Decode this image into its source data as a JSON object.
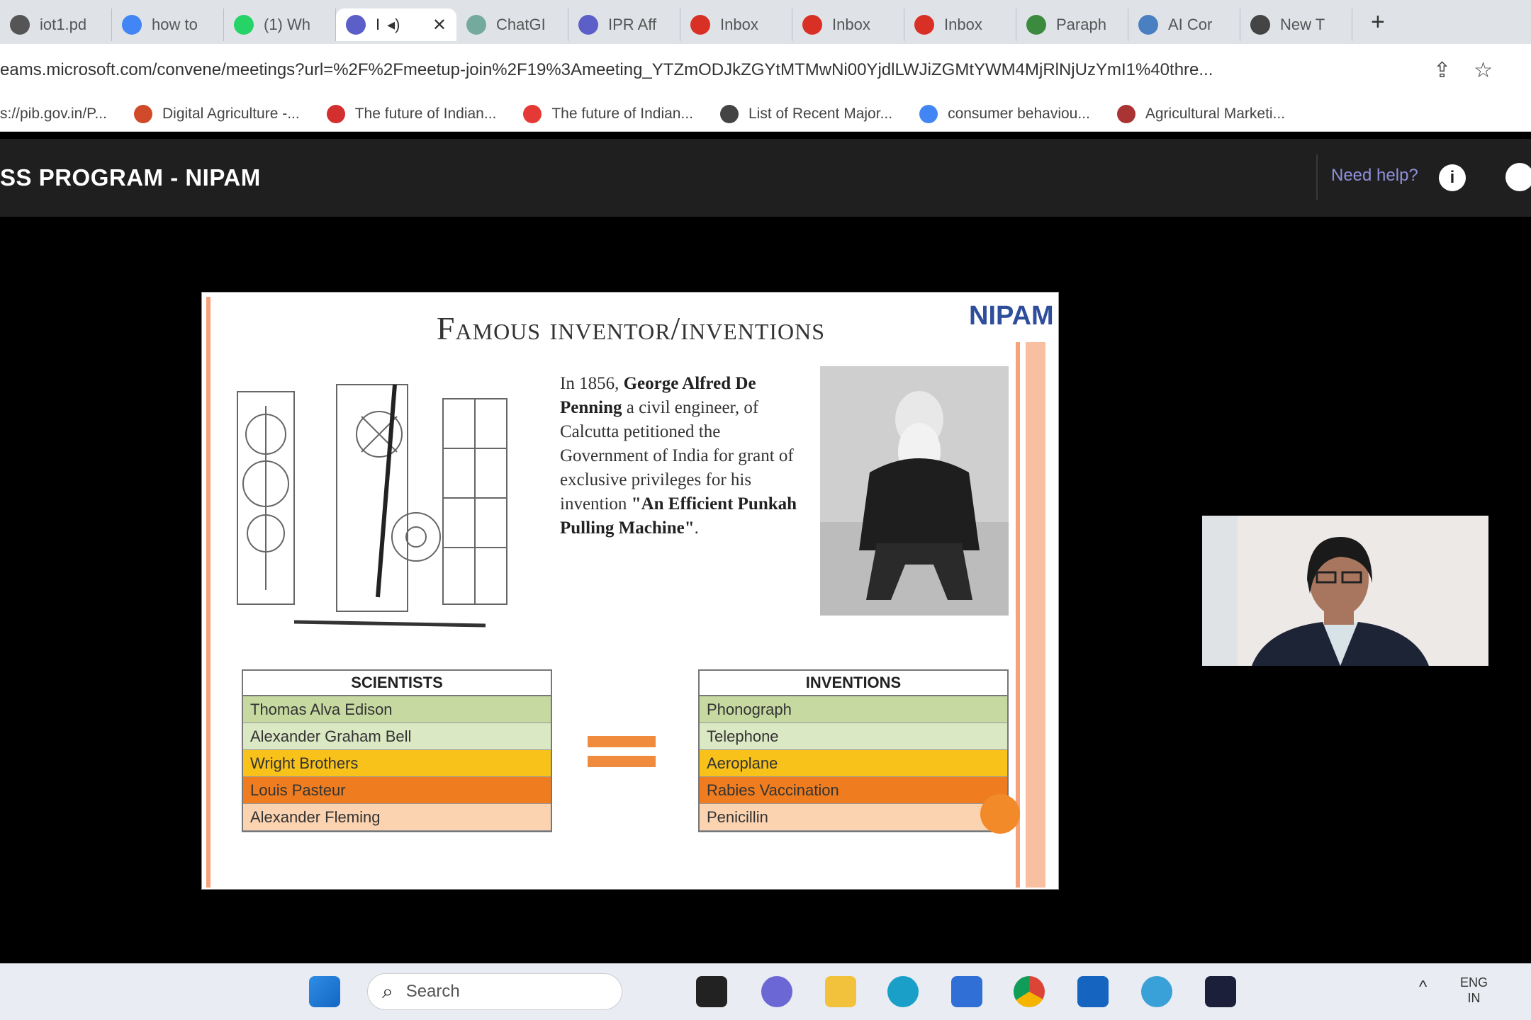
{
  "browser": {
    "tabs": [
      {
        "label": "iot1.pd",
        "icon": "globe-icon",
        "color": "#555555"
      },
      {
        "label": "how to",
        "icon": "google-icon",
        "color": "#4285f4"
      },
      {
        "label": "(1) Wh",
        "icon": "whatsapp-icon",
        "color": "#25d366"
      },
      {
        "label": "I",
        "icon": "teams-icon",
        "color": "#5b5fc7",
        "active": true
      },
      {
        "label": "ChatGI",
        "icon": "chatgpt-icon",
        "color": "#74aa9c"
      },
      {
        "label": "IPR Aff",
        "icon": "teams-icon",
        "color": "#5b5fc7"
      },
      {
        "label": "Inbox",
        "icon": "gmail-icon",
        "color": "#d93025"
      },
      {
        "label": "Inbox",
        "icon": "gmail-icon",
        "color": "#d93025"
      },
      {
        "label": "Inbox",
        "icon": "gmail-icon",
        "color": "#d93025"
      },
      {
        "label": "Paraph",
        "icon": "quillbot-icon",
        "color": "#3b8a3e"
      },
      {
        "label": "AI Cor",
        "icon": "ai-icon",
        "color": "#4a7fc1"
      },
      {
        "label": "New T",
        "icon": "chrome-icon",
        "color": "#444444"
      }
    ],
    "new_tab": "+",
    "url": "eams.microsoft.com/convene/meetings?url=%2F%2Fmeetup-join%2F19%3Ameeting_YTZmODJkZGYtMTMwNi00YjdlLWJiZGMtYWM4MjRlNjUzYmI1%40thre...",
    "bookmarks": [
      {
        "label": "s://pib.gov.in/P...",
        "color": "#888888"
      },
      {
        "label": "Digital Agriculture -...",
        "color": "#d04a2a"
      },
      {
        "label": "The future of Indian...",
        "color": "#d32f2f"
      },
      {
        "label": "The future of Indian...",
        "color": "#e53935"
      },
      {
        "label": "List of Recent Major...",
        "color": "#444444"
      },
      {
        "label": "consumer behaviou...",
        "color": "#4285f4"
      },
      {
        "label": "Agricultural Marketi...",
        "color": "#a33"
      }
    ]
  },
  "teams": {
    "meeting_title": "SS PROGRAM - NIPAM",
    "help_label": "Need help?"
  },
  "slide": {
    "title": "Famous inventor/inventions",
    "logo": "NIPAM",
    "bio_intro": "In 1856, ",
    "bio_name": "George Alfred De Penning",
    "bio_body": " a civil engineer, of Calcutta petitioned the Government of India for grant of exclusive privileges for his invention ",
    "bio_invention": "\"An Efficient Punkah Pulling Machine\"",
    "bio_end": ".",
    "scientists_header": "SCIENTISTS",
    "inventions_header": "INVENTIONS",
    "rows": [
      {
        "scientist": "Thomas Alva Edison",
        "invention": "Phonograph",
        "color": "#c5d9a0"
      },
      {
        "scientist": "Alexander Graham Bell",
        "invention": "Telephone",
        "color": "#dbe8c4"
      },
      {
        "scientist": "Wright Brothers",
        "invention": "Aeroplane",
        "color": "#f8c21b"
      },
      {
        "scientist": "Louis Pasteur",
        "invention": "Rabies Vaccination",
        "color": "#ef7d1f"
      },
      {
        "scientist": "Alexander Fleming",
        "invention": "Penicillin",
        "color": "#fbd3b0"
      }
    ]
  },
  "taskbar": {
    "search_placeholder": "Search",
    "lang": "ENG",
    "region": "IN"
  }
}
